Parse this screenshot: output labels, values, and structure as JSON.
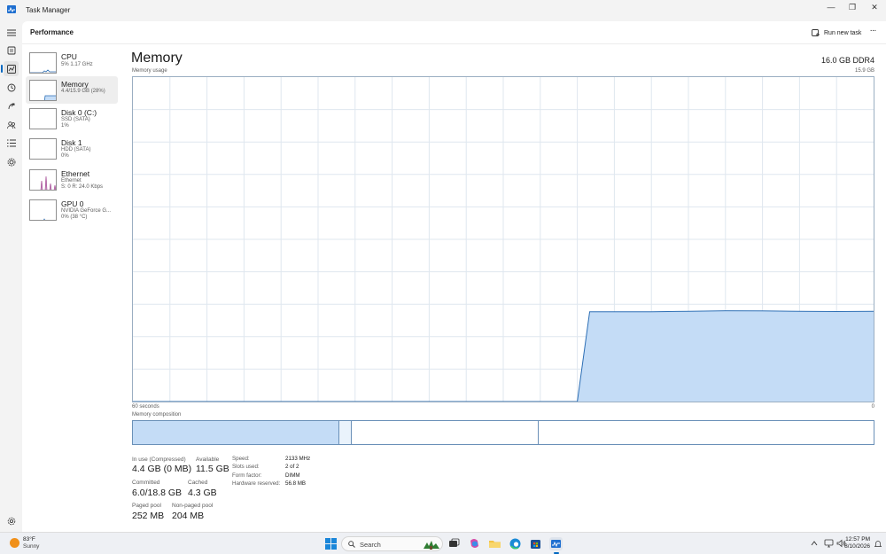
{
  "window": {
    "title": "Task Manager",
    "minimize": "—",
    "maximize": "❐",
    "close": "✕"
  },
  "header": {
    "section": "Performance",
    "run_task": "Run new task",
    "more": "···"
  },
  "rail": [
    "hamburger-icon",
    "processes-icon",
    "performance-icon",
    "app-history-icon",
    "startup-apps-icon",
    "users-icon",
    "details-icon",
    "services-icon",
    "settings-icon"
  ],
  "devices": [
    {
      "name": "CPU",
      "sub1": "5% 1.17 GHz",
      "sub2": ""
    },
    {
      "name": "Memory",
      "sub1": "4.4/15.9 GB (28%)",
      "sub2": ""
    },
    {
      "name": "Disk 0 (C:)",
      "sub1": "SSD (SATA)",
      "sub2": "1%"
    },
    {
      "name": "Disk 1",
      "sub1": "HDD (SATA)",
      "sub2": "0%"
    },
    {
      "name": "Ethernet",
      "sub1": "Ethernet",
      "sub2": "S: 0 R: 24.0 Kbps"
    },
    {
      "name": "GPU 0",
      "sub1": "NVIDIA GeForce G...",
      "sub2": "0% (38 °C)"
    }
  ],
  "panel": {
    "title": "Memory",
    "spec": "16.0 GB DDR4",
    "usage_label": "Memory usage",
    "usage_max": "15.9 GB",
    "time_left": "60 seconds",
    "time_right": "0",
    "composition_label": "Memory composition"
  },
  "chart_data": {
    "type": "area",
    "title": "Memory usage",
    "xlabel": "60 seconds",
    "ylabel": "",
    "xlim": [
      60,
      0
    ],
    "ylim": [
      0,
      15.9
    ],
    "x": [
      60,
      24,
      23,
      18,
      15,
      12,
      9,
      6,
      3,
      0
    ],
    "values": [
      0,
      0,
      4.4,
      4.4,
      4.42,
      4.45,
      4.44,
      4.42,
      4.41,
      4.42
    ],
    "grid": true
  },
  "composition": {
    "in_use_fraction": 0.279,
    "modified_fraction": 0.017,
    "standby_fraction": 0.252,
    "free_fraction": 0.452
  },
  "stats": {
    "in_use_label": "In use (Compressed)",
    "in_use": "4.4 GB (0 MB)",
    "available_label": "Available",
    "available": "11.5 GB",
    "committed_label": "Committed",
    "committed": "6.0/18.8 GB",
    "cached_label": "Cached",
    "cached": "4.3 GB",
    "paged_label": "Paged pool",
    "paged": "252 MB",
    "nonpaged_label": "Non-paged pool",
    "nonpaged": "204 MB"
  },
  "details": [
    {
      "label": "Speed:",
      "value": "2133 MHz"
    },
    {
      "label": "Slots used:",
      "value": "2 of 2"
    },
    {
      "label": "Form factor:",
      "value": "DIMM"
    },
    {
      "label": "Hardware reserved:",
      "value": "56.8 MB"
    }
  ],
  "taskbar": {
    "temp": "83°F",
    "condition": "Sunny",
    "search_placeholder": "Search",
    "time": "12:57 PM",
    "date": "8/10/2026"
  },
  "colors": {
    "accent": "#0067c0",
    "memory_line": "#2d6fb5",
    "memory_fill": "#c4dcf6",
    "grid": "#dfe7ef"
  }
}
